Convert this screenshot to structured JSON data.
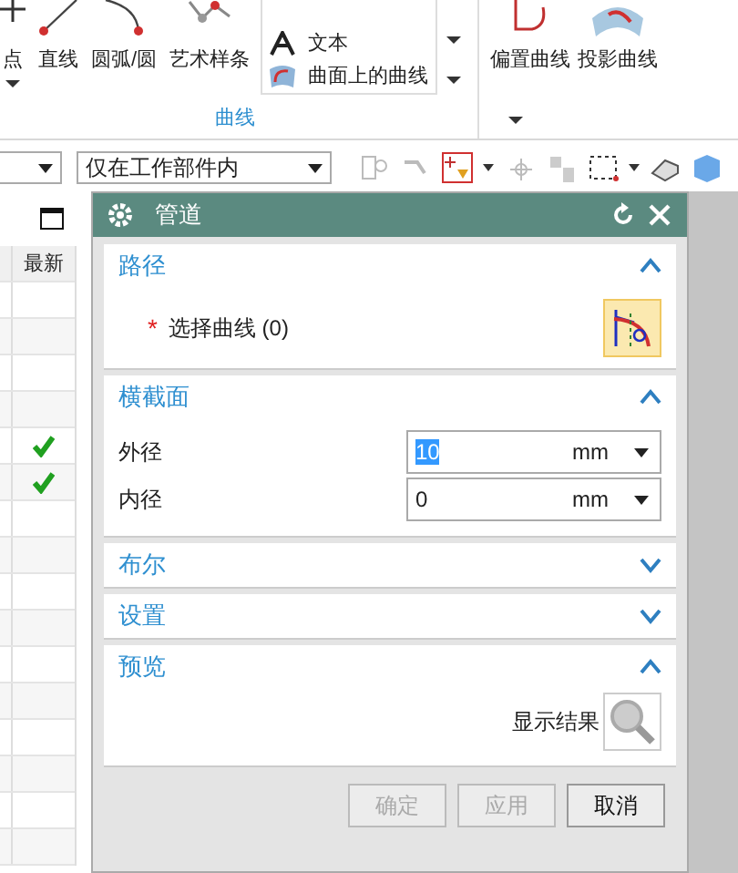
{
  "ribbon": {
    "tools": [
      {
        "kind": "point",
        "label": "点",
        "has_menu": true
      },
      {
        "kind": "line",
        "label": "直线",
        "has_menu": false
      },
      {
        "kind": "arc",
        "label": "圆弧/圆",
        "has_menu": false
      },
      {
        "kind": "spline",
        "label": "艺术样条",
        "has_menu": false
      }
    ],
    "small_tools": [
      {
        "kind": "text",
        "label": "文本"
      },
      {
        "kind": "surface",
        "label": "曲面上的曲线"
      }
    ],
    "group_label": "曲线",
    "right_tools": [
      {
        "kind": "offset",
        "label": "偏置曲线"
      },
      {
        "kind": "project",
        "label": "投影曲线"
      }
    ]
  },
  "toolbar": {
    "scope": "仅在工作部件内"
  },
  "part_list": {
    "column": "最新",
    "rows": [
      {
        "latest": false
      },
      {
        "latest": false
      },
      {
        "latest": false
      },
      {
        "latest": false
      },
      {
        "latest": true
      },
      {
        "latest": true
      },
      {
        "latest": false
      },
      {
        "latest": false
      },
      {
        "latest": false
      },
      {
        "latest": false
      },
      {
        "latest": false
      },
      {
        "latest": false
      },
      {
        "latest": false
      },
      {
        "latest": false
      },
      {
        "latest": false
      },
      {
        "latest": false
      }
    ]
  },
  "dialog": {
    "title": "管道",
    "sections": [
      {
        "kind": "selection",
        "title": "路径",
        "expanded": true,
        "required_mark": "*",
        "label": "选择曲线 (0)"
      },
      {
        "kind": "fields",
        "title": "横截面",
        "expanded": true,
        "fields": [
          {
            "label": "外径",
            "value": "10",
            "unit": "mm",
            "selected": true
          },
          {
            "label": "内径",
            "value": "0",
            "unit": "mm",
            "selected": false
          }
        ]
      },
      {
        "title": "布尔",
        "expanded": false
      },
      {
        "title": "设置",
        "expanded": false
      },
      {
        "kind": "preview",
        "title": "预览",
        "expanded": true,
        "label": "显示结果"
      }
    ],
    "buttons": [
      {
        "label": "确定",
        "disabled": true
      },
      {
        "label": "应用",
        "disabled": true
      },
      {
        "label": "取消",
        "disabled": false
      }
    ]
  }
}
